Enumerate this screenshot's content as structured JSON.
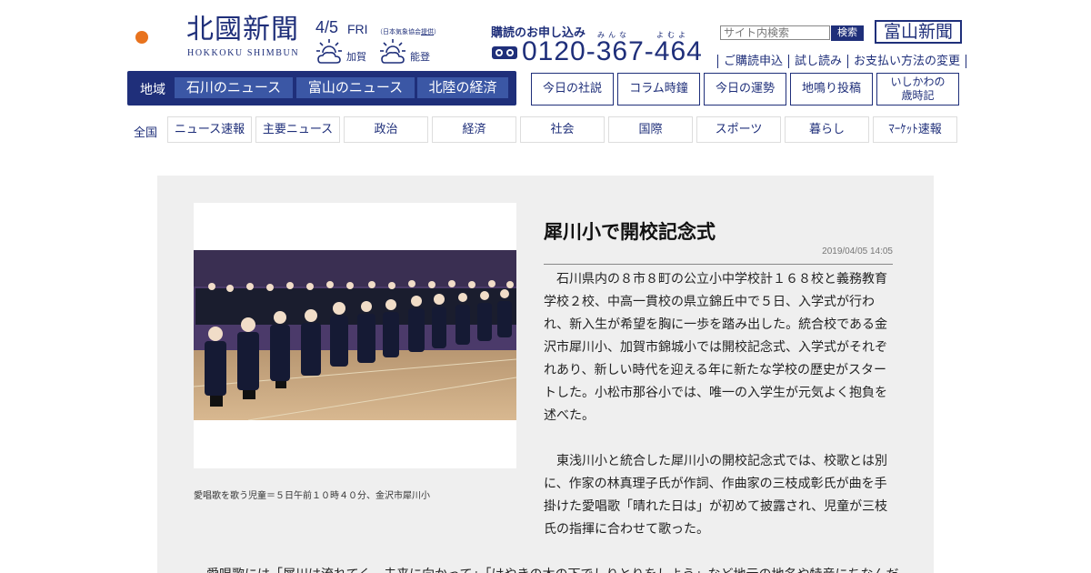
{
  "header": {
    "logo_text": "北國新聞",
    "logo_sub": "HOKKOKU SHIMBUN",
    "date": "4/5",
    "day_of_week": "FRI",
    "weather_credit_prefix": "（日本気象協会",
    "weather_credit_link": "提供",
    "weather_credit_suffix": "）",
    "weather": [
      {
        "area": "加賀",
        "icon": "cloudy-sunny-icon"
      },
      {
        "area": "能登",
        "icon": "cloudy-sunny-icon"
      }
    ],
    "subscription_label": "購読のお申し込み",
    "phone_ruby": [
      "みんな",
      "よむよ"
    ],
    "phone": "0120-367-464",
    "search_placeholder": "サイト内検索",
    "search_button": "検索",
    "toyama_logo": "富山新聞",
    "util_links": [
      "ご購読申込",
      "試し読み",
      "お支払い方法の変更"
    ]
  },
  "region_nav": {
    "label": "地域",
    "tabs": [
      "石川のニュース",
      "富山のニュース",
      "北陸の経済"
    ]
  },
  "column_buttons": [
    {
      "label": "今日の社説"
    },
    {
      "label": "コラム時鐘"
    },
    {
      "label": "今日の運勢"
    },
    {
      "label": "地鳴り投稿"
    },
    {
      "label_line1": "いしかわの",
      "label_line2": "歳時記"
    }
  ],
  "national_nav": {
    "label": "全国",
    "items": [
      "ニュース速報",
      "主要ニュース",
      "政治",
      "経済",
      "社会",
      "国際",
      "スポーツ",
      "暮らし",
      "ﾏｰｹｯﾄ速報"
    ]
  },
  "article": {
    "headline": "犀川小で開校記念式",
    "timestamp": "2019/04/05 14:05",
    "caption": "愛唱歌を歌う児童＝５日午前１０時４０分、金沢市犀川小",
    "paragraphs": [
      "石川県内の８市８町の公立小中学校計１６８校と義務教育学校２校、中高一貫校の県立錦丘中で５日、入学式が行われ、新入生が希望を胸に一歩を踏み出した。統合校である金沢市犀川小、加賀市錦城小では開校記念式、入学式がそれぞれあり、新しい時代を迎える年に新たな学校の歴史がスタートした。小松市那谷小では、唯一の入学生が元気よく抱負を述べた。",
      "東浅川小と統合した犀川小の開校記念式では、校歌とは別に、作家の林真理子氏が作詞、作曲家の三枝成彰氏が曲を手掛けた愛唱歌「晴れた日は」が初めて披露され、児童が三枝氏の指揮に合わせて歌った。"
    ],
    "continuation": "愛唱歌には「犀川は流れてく　未来に向かって」「けやきの木の下でしりとりをしよう」など地元の地名や特産にちなんだ"
  },
  "colors": {
    "brand_navy": "#1f2f7a",
    "tab_blue": "#3b57a5",
    "logo_orange": "#e8731e",
    "article_bg": "#efefef"
  }
}
